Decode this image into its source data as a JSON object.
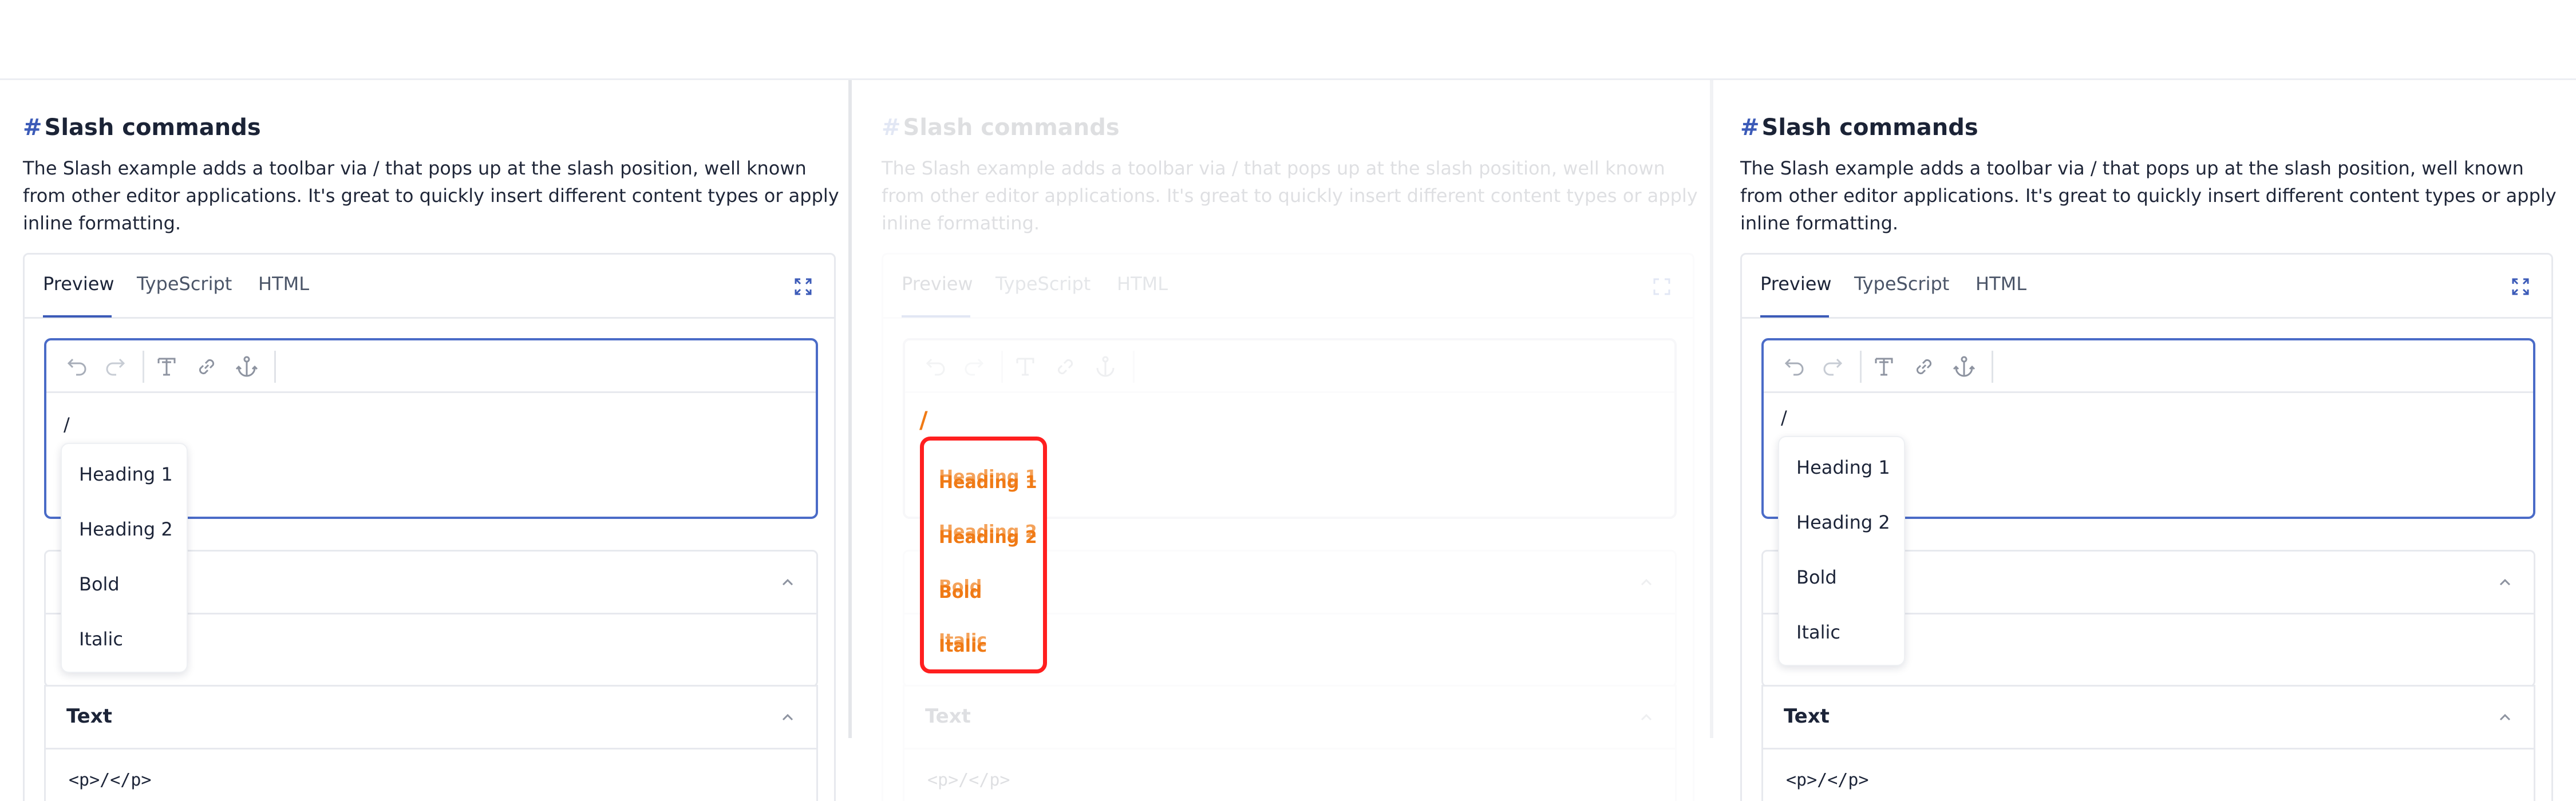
{
  "page": {
    "heading_hash": "#",
    "heading": "Slash commands",
    "description": "The Slash example adds a toolbar via / that pops up at the slash position, well known from other editor applications. It's great to quickly insert different content types or apply inline formatting."
  },
  "tabs": [
    "Preview",
    "TypeScript",
    "HTML"
  ],
  "editor": {
    "content": "/"
  },
  "menu": [
    "Heading 1",
    "Heading 2",
    "Bold",
    "Italic"
  ],
  "sections": {
    "text_title": "Text",
    "text_code": "<p>/</p>"
  },
  "icons": {
    "expand": "expand-icon",
    "undo": "undo-icon",
    "redo": "redo-icon",
    "text": "text-format-icon",
    "link": "link-icon",
    "anchor": "anchor-icon",
    "chevron": "chevron-up-icon"
  },
  "colors": {
    "accent": "#3c5bb8",
    "editor_border": "#4a6bc7",
    "diff_red": "#ff1f1f",
    "diff_orange": "#f07a15"
  }
}
